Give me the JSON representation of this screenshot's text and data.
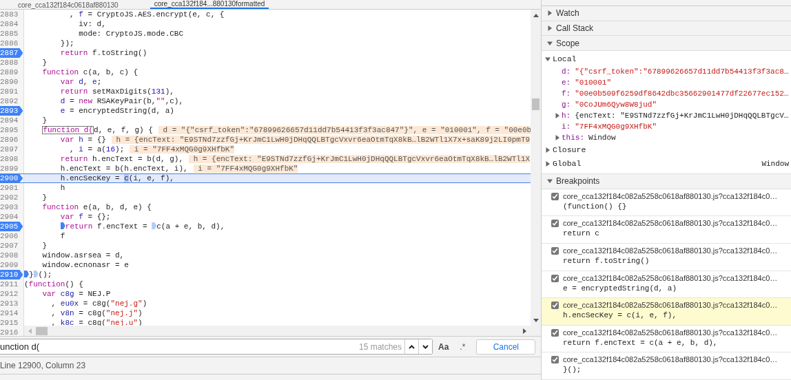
{
  "tabs": [
    {
      "label": "core_cca132f184c0618af880130",
      "selected": false
    },
    {
      "label": "core_cca132f184...880130formatted",
      "selected": true
    }
  ],
  "editor": {
    "lines": [
      {
        "number": "2883",
        "breakpoint": false,
        "current": false,
        "tokens": [
          {
            "kind": "plain",
            "text": "          , "
          },
          {
            "kind": "def",
            "text": "f"
          },
          {
            "kind": "plain",
            "text": " = CryptoJS.AES.encrypt(e, c, {"
          }
        ]
      },
      {
        "number": "2884",
        "breakpoint": false,
        "current": false,
        "tokens": [
          {
            "kind": "plain",
            "text": "            iv: d,"
          }
        ]
      },
      {
        "number": "2885",
        "breakpoint": false,
        "current": false,
        "tokens": [
          {
            "kind": "plain",
            "text": "            mode: CryptoJS.mode.CBC"
          }
        ]
      },
      {
        "number": "2886",
        "breakpoint": false,
        "current": false,
        "tokens": [
          {
            "kind": "plain",
            "text": "        });"
          }
        ]
      },
      {
        "number": "2887",
        "breakpoint": true,
        "current": false,
        "tokens": [
          {
            "kind": "keyword",
            "text": "        return"
          },
          {
            "kind": "plain",
            "text": " f.toString()"
          }
        ]
      },
      {
        "number": "2888",
        "breakpoint": false,
        "current": false,
        "tokens": [
          {
            "kind": "plain",
            "text": "    }"
          }
        ]
      },
      {
        "number": "2889",
        "breakpoint": false,
        "current": false,
        "tokens": [
          {
            "kind": "keyword",
            "text": "    function"
          },
          {
            "kind": "plain",
            "text": " c(a, b, c) {"
          }
        ]
      },
      {
        "number": "2890",
        "breakpoint": false,
        "current": false,
        "tokens": [
          {
            "kind": "keyword",
            "text": "        var"
          },
          {
            "kind": "def",
            "text": " d"
          },
          {
            "kind": "plain",
            "text": ", "
          },
          {
            "kind": "def",
            "text": "e"
          },
          {
            "kind": "plain",
            "text": ";"
          }
        ]
      },
      {
        "number": "2891",
        "breakpoint": false,
        "current": false,
        "tokens": [
          {
            "kind": "keyword",
            "text": "        return"
          },
          {
            "kind": "plain",
            "text": " setMaxDigits("
          },
          {
            "kind": "number",
            "text": "131"
          },
          {
            "kind": "plain",
            "text": "),"
          }
        ]
      },
      {
        "number": "2892",
        "breakpoint": false,
        "current": false,
        "tokens": [
          {
            "kind": "def",
            "text": "        d"
          },
          {
            "kind": "plain",
            "text": " = "
          },
          {
            "kind": "keyword",
            "text": "new"
          },
          {
            "kind": "plain",
            "text": " RSAKeyPair(b,"
          },
          {
            "kind": "string",
            "text": "\"\""
          },
          {
            "kind": "plain",
            "text": ",c),"
          }
        ]
      },
      {
        "number": "2893",
        "breakpoint": true,
        "current": false,
        "tokens": [
          {
            "kind": "def",
            "text": "        e"
          },
          {
            "kind": "plain",
            "text": " = encryptedString(d, a)"
          }
        ]
      },
      {
        "number": "2894",
        "breakpoint": false,
        "current": false,
        "tokens": [
          {
            "kind": "plain",
            "text": "    }"
          }
        ]
      },
      {
        "number": "2895",
        "breakpoint": false,
        "current": false,
        "tokens": [
          {
            "kind": "match",
            "text": "    function d("
          },
          {
            "kind": "plain",
            "text": "d, e, f, g) {"
          }
        ],
        "inline_value": " d = \"{\"csrf_token\":\"67899626657d11dd7b54413f3f3ac847\"}\", e = \"010001\", f = \"00e0b"
      },
      {
        "number": "2896",
        "breakpoint": false,
        "current": false,
        "tokens": [
          {
            "kind": "keyword",
            "text": "        var"
          },
          {
            "kind": "def",
            "text": " h"
          },
          {
            "kind": "plain",
            "text": " = {}"
          }
        ],
        "inline_value": " h = {encText: \"E9STNd7zzfGj+KrJmC1LwH0jDHqQQLBTgcVxvr6eaOtmTqX8kB…lB2WTl1X7x+saK89j2LI0pmT9"
      },
      {
        "number": "2897",
        "breakpoint": false,
        "current": false,
        "tokens": [
          {
            "kind": "plain",
            "text": "          , "
          },
          {
            "kind": "def",
            "text": "i"
          },
          {
            "kind": "plain",
            "text": " = a("
          },
          {
            "kind": "number",
            "text": "16"
          },
          {
            "kind": "plain",
            "text": ");"
          }
        ],
        "inline_value": " i = \"7FF4xMQG0g9XHfbK\""
      },
      {
        "number": "2898",
        "breakpoint": false,
        "current": false,
        "tokens": [
          {
            "kind": "keyword",
            "text": "        return"
          },
          {
            "kind": "plain",
            "text": " h.encText = b(d, g),"
          }
        ],
        "inline_value": " h = {encText: \"E9STNd7zzfGj+KrJmC1LwH0jDHqQQLBTgcVxvr6eaOtmTqX8kB…lB2WTl1X"
      },
      {
        "number": "2899",
        "breakpoint": false,
        "current": false,
        "tokens": [
          {
            "kind": "plain",
            "text": "        h.encText = b(h.encText, i),"
          }
        ],
        "inline_value": " i = \"7FF4xMQG0g9XHfbK\""
      },
      {
        "number": "2900",
        "breakpoint": true,
        "current": true,
        "tokens": [
          {
            "kind": "plain",
            "text": "        h.encSecKey = "
          },
          {
            "kind": "selection",
            "text": "c"
          },
          {
            "kind": "plain",
            "text": "(i, e, f),"
          }
        ]
      },
      {
        "number": "2901",
        "breakpoint": false,
        "current": false,
        "tokens": [
          {
            "kind": "plain",
            "text": "        h"
          }
        ]
      },
      {
        "number": "2902",
        "breakpoint": false,
        "current": false,
        "tokens": [
          {
            "kind": "plain",
            "text": "    }"
          }
        ]
      },
      {
        "number": "2903",
        "breakpoint": false,
        "current": false,
        "tokens": [
          {
            "kind": "keyword",
            "text": "    function"
          },
          {
            "kind": "plain",
            "text": " e(a, b, d, e) {"
          }
        ]
      },
      {
        "number": "2904",
        "breakpoint": false,
        "current": false,
        "tokens": [
          {
            "kind": "keyword",
            "text": "        var"
          },
          {
            "kind": "def",
            "text": " f"
          },
          {
            "kind": "plain",
            "text": " = {};"
          }
        ]
      },
      {
        "number": "2905",
        "breakpoint": true,
        "current": false,
        "tokens": [
          {
            "kind": "marker",
            "active": true
          },
          {
            "kind": "keyword",
            "text": "        return"
          },
          {
            "kind": "plain",
            "text": " f.encText = "
          },
          {
            "kind": "marker",
            "active": false
          },
          {
            "kind": "plain",
            "text": "c(a + e, b, d),"
          }
        ]
      },
      {
        "number": "2906",
        "breakpoint": false,
        "current": false,
        "tokens": [
          {
            "kind": "plain",
            "text": "        f"
          }
        ]
      },
      {
        "number": "2907",
        "breakpoint": false,
        "current": false,
        "tokens": [
          {
            "kind": "plain",
            "text": "    }"
          }
        ]
      },
      {
        "number": "2908",
        "breakpoint": false,
        "current": false,
        "tokens": [
          {
            "kind": "plain",
            "text": "    window.asrsea = d,"
          }
        ]
      },
      {
        "number": "2909",
        "breakpoint": false,
        "current": false,
        "tokens": [
          {
            "kind": "plain",
            "text": "    window.ecnonasr = e"
          }
        ]
      },
      {
        "number": "2910",
        "breakpoint": true,
        "current": false,
        "tokens": [
          {
            "kind": "marker",
            "active": true
          },
          {
            "kind": "plain",
            "text": "}"
          },
          {
            "kind": "marker",
            "active": false
          },
          {
            "kind": "plain",
            "text": "();"
          }
        ]
      },
      {
        "number": "2911",
        "breakpoint": false,
        "current": false,
        "tokens": [
          {
            "kind": "plain",
            "text": "("
          },
          {
            "kind": "keyword",
            "text": "function"
          },
          {
            "kind": "plain",
            "text": "() {"
          }
        ]
      },
      {
        "number": "2912",
        "breakpoint": false,
        "current": false,
        "tokens": [
          {
            "kind": "keyword",
            "text": "    var"
          },
          {
            "kind": "def",
            "text": " c8g"
          },
          {
            "kind": "plain",
            "text": " = NEJ.P"
          }
        ]
      },
      {
        "number": "2913",
        "breakpoint": false,
        "current": false,
        "tokens": [
          {
            "kind": "plain",
            "text": "      , "
          },
          {
            "kind": "def",
            "text": "eu0x"
          },
          {
            "kind": "plain",
            "text": " = c8g("
          },
          {
            "kind": "string",
            "text": "\"nej.g\""
          },
          {
            "kind": "plain",
            "text": ")"
          }
        ]
      },
      {
        "number": "2914",
        "breakpoint": false,
        "current": false,
        "tokens": [
          {
            "kind": "plain",
            "text": "      , "
          },
          {
            "kind": "def",
            "text": "v8n"
          },
          {
            "kind": "plain",
            "text": " = c8g("
          },
          {
            "kind": "string",
            "text": "\"nej.j\""
          },
          {
            "kind": "plain",
            "text": ")"
          }
        ]
      },
      {
        "number": "2915",
        "breakpoint": false,
        "current": false,
        "tokens": [
          {
            "kind": "plain",
            "text": "      , "
          },
          {
            "kind": "def",
            "text": "k8c"
          },
          {
            "kind": "plain",
            "text": " = c8g("
          },
          {
            "kind": "string",
            "text": "\"nej.u\""
          },
          {
            "kind": "plain",
            "text": ")"
          }
        ]
      },
      {
        "number": "2916",
        "breakpoint": false,
        "current": false
      }
    ]
  },
  "search": {
    "value": "unction d(",
    "match_count": "15 matches",
    "case_button": "Aa",
    "regex_button": ".*",
    "cancel": "Cancel"
  },
  "status_bar": "Line 12900, Column 23",
  "sidebar": {
    "sections": [
      {
        "title": "Watch",
        "expanded": false
      },
      {
        "title": "Call Stack",
        "expanded": false
      },
      {
        "title": "Scope",
        "expanded": true,
        "scopes": [
          {
            "name": "Local",
            "expanded": true,
            "variables": [
              {
                "name": "d:",
                "value": "\"{\"csrf_token\":\"67899626657d11dd7b54413f3f3ac8…",
                "kind": "string",
                "expandable": false
              },
              {
                "name": "e:",
                "value": "\"010001\"",
                "kind": "string",
                "expandable": false
              },
              {
                "name": "f:",
                "value": "\"00e0b509f6259df8642dbc35662901477df22677ec152…",
                "kind": "string",
                "expandable": false
              },
              {
                "name": "g:",
                "value": "\"0CoJUm6Qyw8W8jud\"",
                "kind": "string",
                "expandable": false
              },
              {
                "name": "h:",
                "value": "{encText: \"E9STNd7zzfGj+KrJmC1LwH0jDHqQQLBTgcV…",
                "kind": "object",
                "expandable": true
              },
              {
                "name": "i:",
                "value": "\"7FF4xMQG0g9XHfbK\"",
                "kind": "string",
                "expandable": false
              },
              {
                "name": "this:",
                "value": "Window",
                "kind": "object",
                "expandable": true
              }
            ]
          },
          {
            "name": "Closure",
            "expanded": false
          },
          {
            "name": "Global",
            "expanded": false,
            "value": "Window"
          }
        ]
      },
      {
        "title": "Breakpoints",
        "expanded": true,
        "breakpoints": [
          {
            "file": "core_cca132f184c082a5258c0618af880130.js?cca132f184c0…",
            "code": "(function() {}",
            "checked": true,
            "selected": false
          },
          {
            "file": "core_cca132f184c082a5258c0618af880130.js?cca132f184c0…",
            "code": "return c",
            "checked": true,
            "selected": false
          },
          {
            "file": "core_cca132f184c082a5258c0618af880130.js?cca132f184c0…",
            "code": "return f.toString()",
            "checked": true,
            "selected": false
          },
          {
            "file": "core_cca132f184c082a5258c0618af880130.js?cca132f184c0…",
            "code": "e = encryptedString(d, a)",
            "checked": true,
            "selected": false
          },
          {
            "file": "core_cca132f184c082a5258c0618af880130.js?cca132f184c0…",
            "code": "h.encSecKey = c(i, e, f),",
            "checked": true,
            "selected": true
          },
          {
            "file": "core_cca132f184c082a5258c0618af880130.js?cca132f184c0…",
            "code": "return f.encText = c(a + e, b, d),",
            "checked": true,
            "selected": false
          },
          {
            "file": "core_cca132f184c082a5258c0618af880130.js?cca132f184c0…",
            "code": "}();",
            "checked": true,
            "selected": false
          }
        ]
      }
    ]
  }
}
